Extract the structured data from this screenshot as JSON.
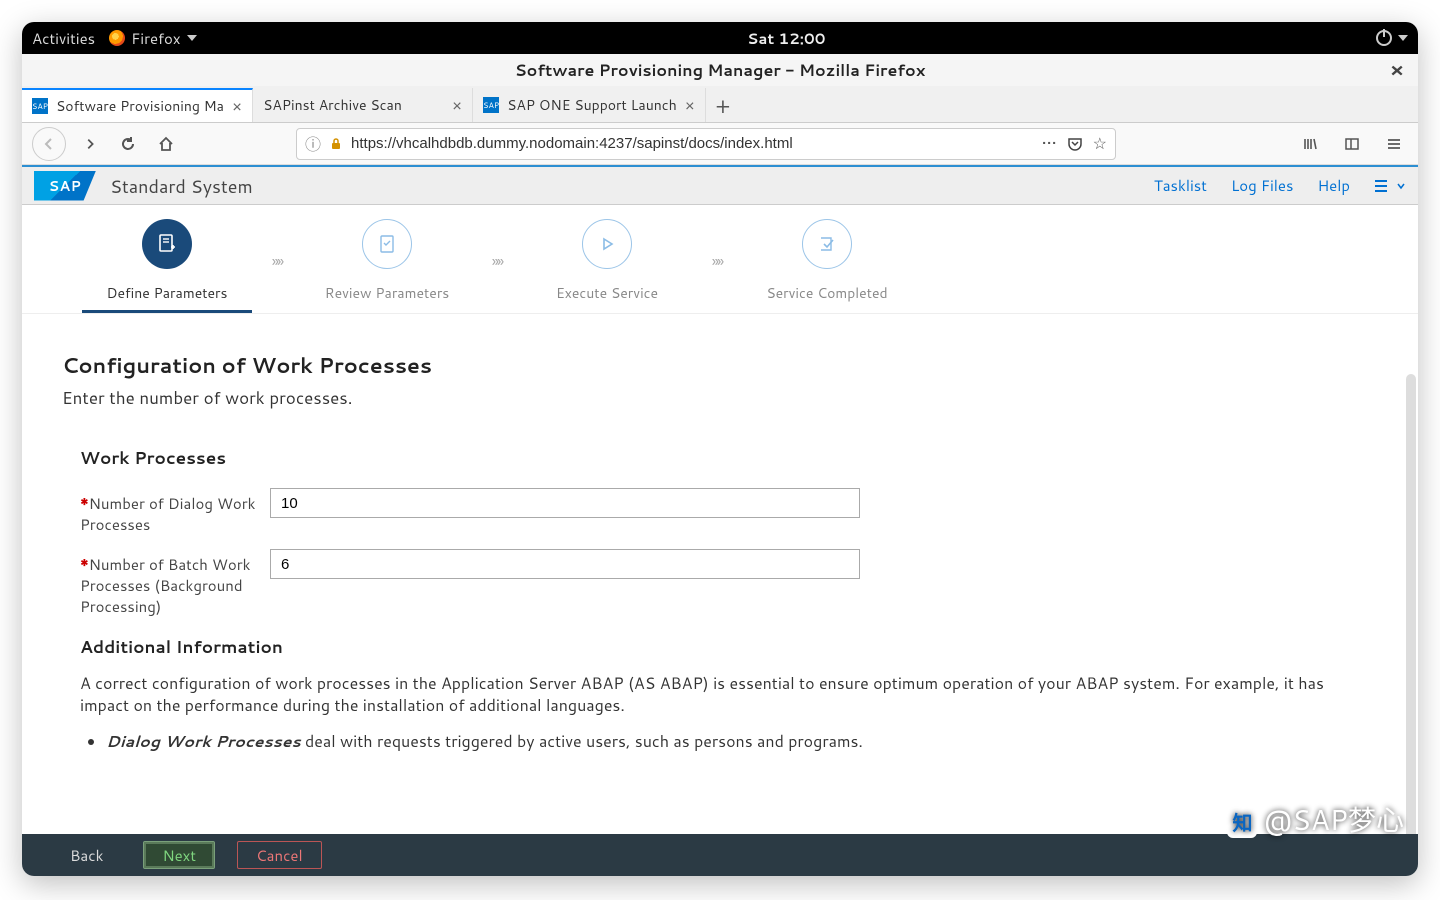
{
  "gnome": {
    "activities": "Activities",
    "app": "Firefox",
    "time": "Sat 12:00"
  },
  "window_title": "Software Provisioning Manager - Mozilla Firefox",
  "tabs": [
    {
      "label": "Software Provisioning Ma",
      "active": true
    },
    {
      "label": "SAPinst Archive Scan",
      "active": false
    },
    {
      "label": "SAP ONE Support Launch",
      "active": false
    }
  ],
  "url": "https://vhcalhdbdb.dummy.nodomain:4237/sapinst/docs/index.html",
  "sap": {
    "logo": "SAP",
    "system": "Standard System",
    "links": {
      "tasklist": "Tasklist",
      "logfiles": "Log Files",
      "help": "Help"
    }
  },
  "wizard": {
    "steps": [
      {
        "label": "Define Parameters",
        "active": true
      },
      {
        "label": "Review Parameters",
        "active": false
      },
      {
        "label": "Execute Service",
        "active": false
      },
      {
        "label": "Service Completed",
        "active": false
      }
    ]
  },
  "page": {
    "title": "Configuration of Work Processes",
    "subtitle": "Enter the number of work processes.",
    "section": "Work Processes",
    "fields": {
      "dialog_label": "Number of Dialog Work Processes",
      "dialog_value": "10",
      "batch_label": "Number of Batch Work Processes (Background Processing)",
      "batch_value": "6"
    },
    "info_heading": "Additional Information",
    "info_para": "A correct configuration of work processes in the Application Server ABAP (AS ABAP) is essential to ensure optimum operation of your ABAP system. For example, it has impact on the performance during the installation of additional languages.",
    "info_bullet_em": "Dialog Work Processes",
    "info_bullet_rest": " deal with requests triggered by active users, such as persons and programs."
  },
  "footer": {
    "back": "Back",
    "next": "Next",
    "cancel": "Cancel"
  },
  "watermark": "@SAP梦心"
}
